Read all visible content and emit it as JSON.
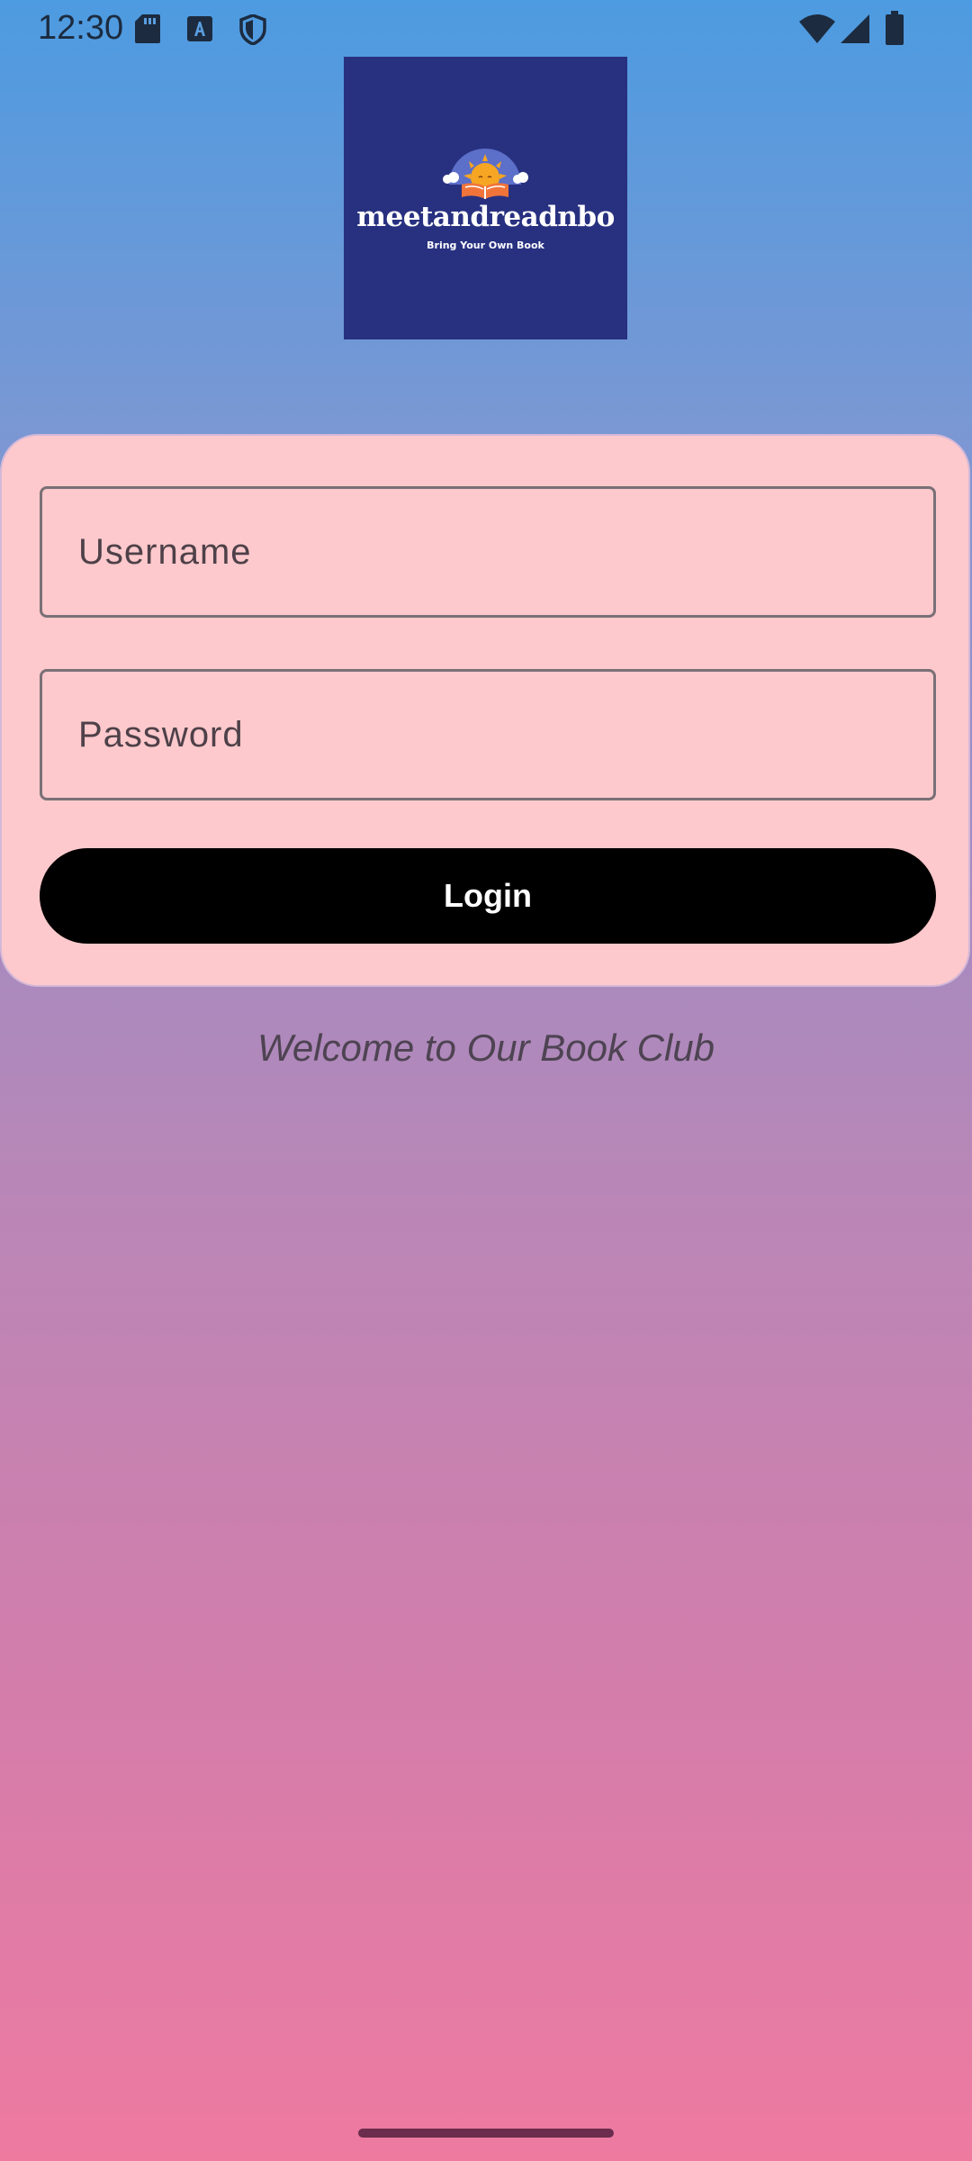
{
  "status_bar": {
    "time": "12:30",
    "left_icons": [
      "sd-card-icon",
      "text-a-icon",
      "shield-icon"
    ],
    "right_icons": [
      "wifi-icon",
      "cellular-signal-icon",
      "battery-icon"
    ]
  },
  "logo": {
    "wordmark": "meetandreadnbo",
    "tagline": "Bring Your Own Book",
    "background_color": "#283180",
    "icon": "sun-with-book-icon"
  },
  "login_form": {
    "username_placeholder": "Username",
    "password_placeholder": "Password",
    "login_label": "Login",
    "card_color": "#fec9cc",
    "button_color": "#000000"
  },
  "welcome_text": "Welcome to Our Book Club",
  "colors": {
    "gradient_top": "#4d9be1",
    "gradient_bottom": "#ee7aa0",
    "text_dark": "#1c2b3f"
  }
}
